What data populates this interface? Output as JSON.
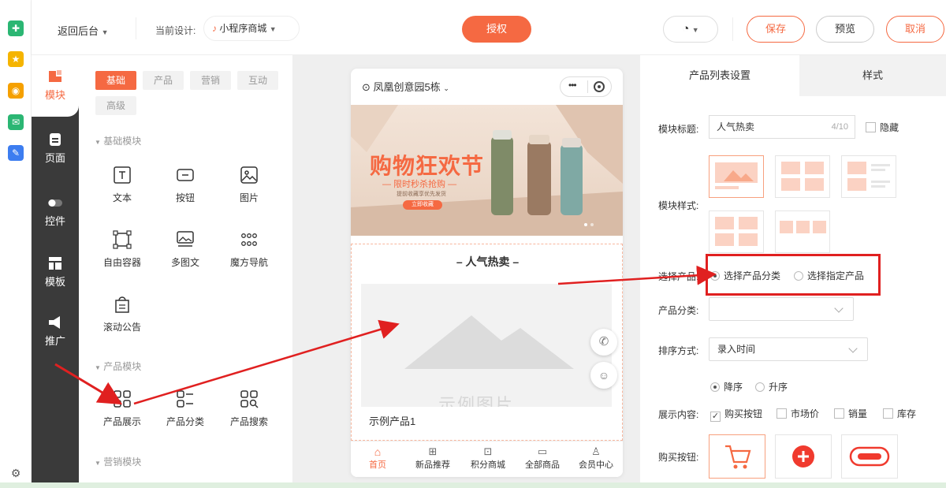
{
  "topbar": {
    "back_label": "返回后台",
    "current_design_label": "当前设计:",
    "design_name": "小程序商城",
    "authorize_label": "授权",
    "save_label": "保存",
    "preview_label": "预览",
    "cancel_label": "取消"
  },
  "left_nav": {
    "items": [
      {
        "label": "模块",
        "icon": "module-icon"
      },
      {
        "label": "页面",
        "icon": "page-icon"
      },
      {
        "label": "控件",
        "icon": "toggle-icon"
      },
      {
        "label": "模板",
        "icon": "template-icon"
      },
      {
        "label": "推广",
        "icon": "megaphone-icon"
      }
    ]
  },
  "module_panel": {
    "tabs": [
      "基础",
      "产品",
      "营销",
      "互动",
      "高级"
    ],
    "sections": {
      "basic": "基础模块",
      "product": "产品模块",
      "marketing": "营销模块"
    },
    "basic_modules": [
      "文本",
      "按钮",
      "图片",
      "自由容器",
      "多图文",
      "魔方导航",
      "滚动公告"
    ],
    "product_modules": [
      "产品展示",
      "产品分类",
      "产品搜索"
    ]
  },
  "phone": {
    "location": "凤凰创意园5栋",
    "banner": {
      "title": "购物狂欢节",
      "subtitle": "— 限时秒杀抢购 —",
      "small": "提前收藏享优先发货",
      "button": "立即收藏"
    },
    "section_title": "人气热卖",
    "placeholder_text": "示例图片",
    "product_name": "示例产品1",
    "tabbar": [
      "首页",
      "新品推荐",
      "积分商城",
      "全部商品",
      "会员中心"
    ]
  },
  "right_panel": {
    "tabs": [
      "产品列表设置",
      "样式"
    ],
    "module_title_label": "模块标题:",
    "module_title_value": "人气热卖",
    "module_title_count": "4/10",
    "hide_label": "隐藏",
    "module_style_label": "模块样式:",
    "select_product_label": "选择产品:",
    "select_by_category": "选择产品分类",
    "select_specific": "选择指定产品",
    "category_label": "产品分类:",
    "sort_label": "排序方式:",
    "sort_value": "录入时间",
    "desc_label": "降序",
    "asc_label": "升序",
    "display_label": "展示内容:",
    "display_options": [
      "购买按钮",
      "市场价",
      "销量",
      "库存"
    ],
    "buy_button_label": "购买按钮:"
  },
  "colors": {
    "accent": "#f56942",
    "dark_nav": "#3a3a3a",
    "highlight_box": "#e02020"
  }
}
